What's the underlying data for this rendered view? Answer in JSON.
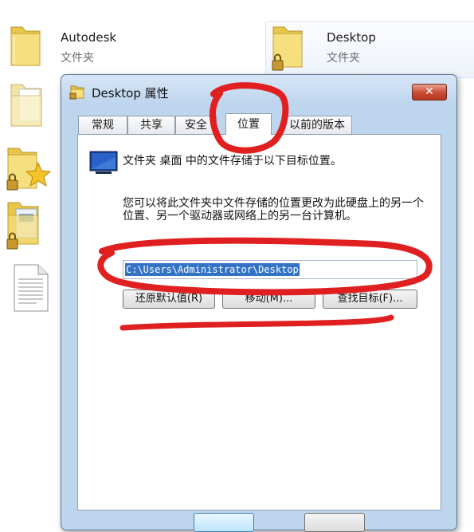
{
  "explorer": {
    "items": [
      {
        "name": "Autodesk",
        "type": "文件夹"
      },
      {
        "name": "Desktop",
        "type": "文件夹"
      }
    ]
  },
  "dialog": {
    "title": "Desktop 属性",
    "close_label": "✕",
    "tabs": [
      "常规",
      "共享",
      "安全",
      "位置",
      "以前的版本"
    ],
    "active_tab": "位置",
    "location": {
      "heading": "文件夹 桌面 中的文件存储于以下目标位置。",
      "description": "您可以将此文件夹中文件存储的位置更改为此硬盘上的另一个位置、另一个驱动器或网络上的另一台计算机。",
      "path_value": "C:\\Users\\Administrator\\Desktop",
      "buttons": {
        "restore_default": "还原默认值(R)",
        "move": "移动(M)...",
        "find_target": "查找目标(F)..."
      }
    }
  },
  "colors": {
    "annotation_red": "#e02020",
    "selection_blue": "#3373c6",
    "dialog_frame": "#bed5ee"
  }
}
